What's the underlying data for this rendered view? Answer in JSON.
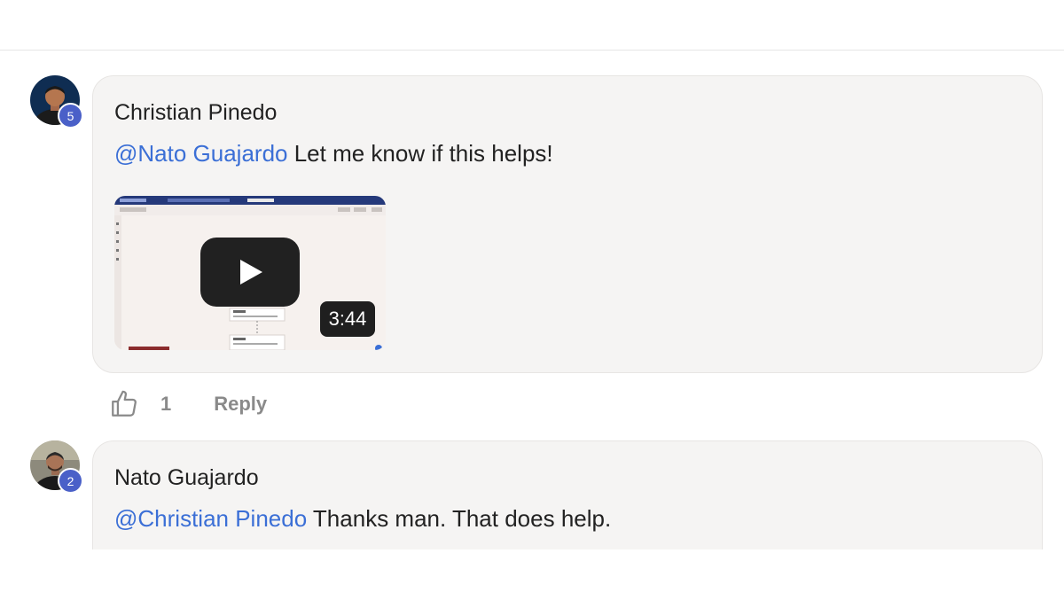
{
  "comments": [
    {
      "author": "Christian Pinedo",
      "level": "5",
      "mention": "@Nato Guajardo",
      "text": " Let me know if this helps!",
      "video": {
        "duration": "3:44",
        "icon": "play-icon"
      },
      "likes": "1",
      "reply_label": "Reply",
      "like_icon": "thumbs-up-icon"
    },
    {
      "author": "Nato Guajardo",
      "level": "2",
      "mention": "@Christian Pinedo",
      "text": " Thanks man. That does help."
    }
  ],
  "colors": {
    "mention": "#3b6fd6",
    "badge": "#4a60c8",
    "bubble": "#f5f4f3",
    "muted": "#8a8a8a"
  }
}
